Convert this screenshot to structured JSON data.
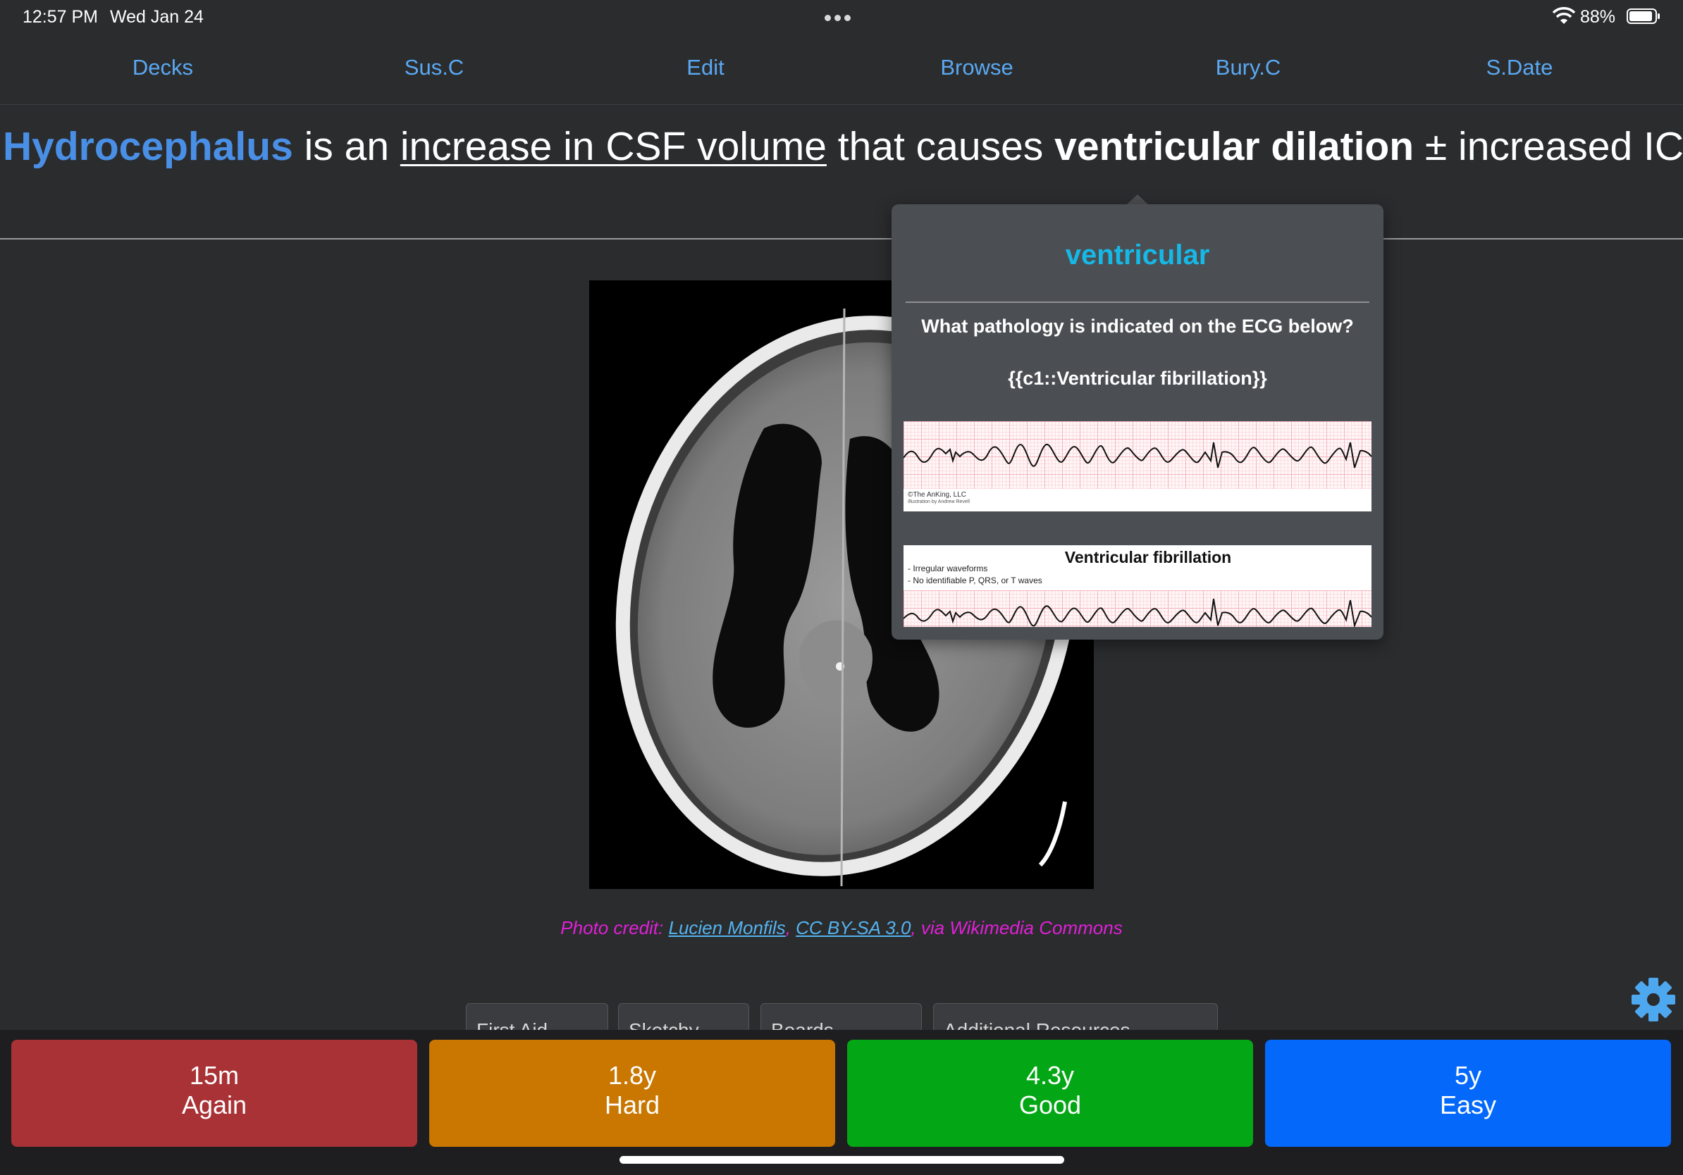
{
  "status_bar": {
    "time": "12:57 PM",
    "date": "Wed Jan 24",
    "battery_pct": "88%"
  },
  "toolbar": {
    "items": [
      "Decks",
      "Sus.C",
      "Edit",
      "Browse",
      "Bury.C",
      "S.Date"
    ]
  },
  "question": {
    "term": "Hydrocephalus",
    "t1": " is an ",
    "underlined": "increase in CSF volume",
    "t2": " that causes ",
    "bold": "ventricular dilation",
    "t3": " ± increased ICP"
  },
  "credit": {
    "prefix": "Photo credit: ",
    "author": "Lucien Monfils",
    "sep": ", ",
    "license": "CC BY-SA 3.0",
    "suffix": ", via Wikimedia Commons"
  },
  "popup": {
    "title": "ventricular",
    "question": "What pathology is indicated on the ECG below?",
    "cloze": "{{c1::Ventricular fibrillation}}",
    "ecg1_copyright": "©The AnKing, LLC",
    "ecg1_illustrator": "Illustration by Andrew Revell",
    "ecg2_heading": "Ventricular fibrillation",
    "ecg2_bullet1": "- Irregular waveforms",
    "ecg2_bullet2": "- No identifiable P, QRS, or T waves"
  },
  "tabs_partial": [
    "First Aid",
    "Sketchy",
    "Boards",
    "Additional Resources"
  ],
  "answers": {
    "again": {
      "interval": "15m",
      "label": "Again",
      "color": "#a83235"
    },
    "hard": {
      "interval": "1.8y",
      "label": "Hard",
      "color": "#c97700"
    },
    "good": {
      "interval": "4.3y",
      "label": "Good",
      "color": "#03a614"
    },
    "easy": {
      "interval": "5y",
      "label": "Easy",
      "color": "#0469fb"
    }
  },
  "icons": {
    "settings": "gear-icon",
    "wifi": "wifi-icon",
    "battery": "battery-icon",
    "more": "more-dots-icon"
  },
  "colors": {
    "background": "#2b2c2e",
    "accent_blue": "#5aa9f2",
    "term_blue": "#4a8fe6",
    "popup_title": "#16b8e6",
    "credit_magenta": "#e020d8"
  }
}
